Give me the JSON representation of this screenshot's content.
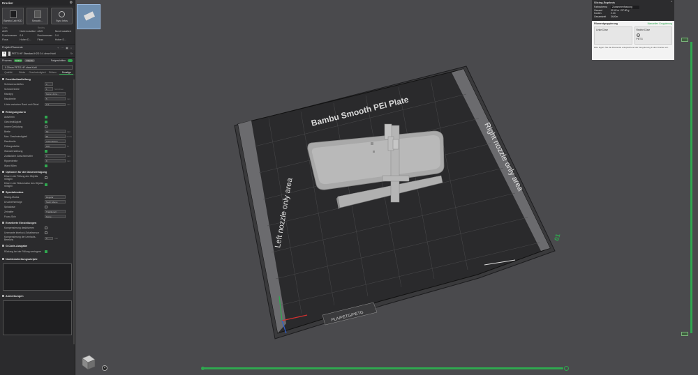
{
  "left": {
    "printer_header": "Drucker",
    "printer_name": "Bambu Lab H2D",
    "smooth_label": "Smooth...",
    "sync_label": "Sync Infos",
    "left_caption": "Links",
    "right_caption": "Rechts",
    "nozzle_info": {
      "ams_label": "AMS",
      "ams_value": "Nicht installiert",
      "diam_label": "Durchmesser",
      "diam_value": "0.4",
      "flow_label": "Fluss",
      "flow_value": "Hoher D..."
    },
    "filament_header": "Projekt-Filamente",
    "filament_1_num": "1",
    "filament_1_name": "PETG HF Standard H2D 0.4 ohne Kahl",
    "process_label": "Prozess",
    "process_pill_1": "Global",
    "process_pill_2": "Objekte",
    "advanced_label": "Fortgeschritten",
    "preset_name": "0.20mm PETG HF ohne Kahl",
    "tabs": [
      "Qualität",
      "Stärke",
      "Geschwindigkeit",
      "Stützen",
      "Sonstige"
    ],
    "groups": {
      "g1": "Druckbettaufteilung",
      "g2": "Reinigungsturm",
      "g3": "Optionen für die Düsenreinigung",
      "g4": "Spezialmodus",
      "g5": "Erweiterte Einstellungen",
      "g6": "G-Code-Ausgabe",
      "g7": "Nachbearbeitungsskripte",
      "g8": "Anmerkungen"
    },
    "rows": {
      "r1_l": "Schürzenschleifen",
      "r1_v": "0",
      "r2_l": "Schürzenhöhe",
      "r2_v": "1",
      "r2_u": "Schichten",
      "r3_l": "Randtyp",
      "r3_v": "Keine Umra...",
      "r4_l": "Randbreite",
      "r4_v": "5",
      "r4_u": "mm",
      "r5_l": "Lücke zwischen Rand und Obkel",
      "r5_v": "0.1",
      "r5_u": "mm",
      "t1": "Aktivieren",
      "t2": "Gleichmäßigkeit",
      "t3": "Innere Gerüstung",
      "t4_l": "Breite",
      "t4_v": "60",
      "t4_u": "mm",
      "t5_l": "Max. Geschwindigkeit",
      "t5_v": "90",
      "t5_u": "mm/s",
      "t6_l": "Randbreite",
      "t6_v": "Automatisch",
      "t7_l": "Füllungsdichte",
      "t7_v": "100",
      "t7_u": "%",
      "t8": "Wandverstärkung",
      "t9_l": "Zusätzliche Zwischenhafter",
      "t9_v": "0",
      "t9_u": "mm",
      "t10_l": "Rippenbreite",
      "t10_v": "8",
      "t10_u": "mm",
      "t11": "Wand füllen",
      "o1": "Düse in der Füllung des Objekts reinigen",
      "o2": "Düse in der Stützstruktur des Objekts reinigen",
      "s1_l": "Slicing-Modus",
      "s1_v": "Regulär",
      "s2_l": "Druckreihenfolge",
      "s2_v": "Nach Ebene",
      "s3": "Spiralvase",
      "s4_l": "Zeitraffer",
      "s4_v": "Traditionell",
      "s5_l": "Fuzzy Skin",
      "s5_v": "Keine",
      "e1": "Kompensierung deaktivieren",
      "e2": "Unerwarte Interlock-Schaltsensor",
      "e3_l": "Kompensierung der Leerlaufs-Bereichs",
      "e3_v": "0",
      "e3_u": "mm",
      "gc1": "Rückzug bei der Füllung verringern"
    }
  },
  "plate": {
    "title": "Bambu Smooth PEI Plate",
    "left_area": "Left nozzle only area",
    "right_area": "Right nozzle only area",
    "brand_strip": "PLA/PETG/PETG",
    "plate_number": "01"
  },
  "result": {
    "title": "Slicing-Ergebnis",
    "row1_l": "Farbschema",
    "row1_v": "Zusammenfassung",
    "row2_l": "Gesamt",
    "row2_v": "32.42 m / 97.80 g",
    "row3_l": "Kosten",
    "row3_v": "2.44",
    "row4_l": "Gesamtzeit",
    "row4_v": "3h20m",
    "fil_title": "Filamentgruppierung",
    "fil_action": "Manuellen Gruppierung",
    "left_box": "Linke Düse",
    "right_box": "Rechte Düse",
    "right_box_num": "1",
    "right_box_mat": "PETG",
    "note": "Bitte lagern Sie die Filamente entsprechend der Gruppierung in den Drucker ein."
  },
  "colors": {
    "accent": "#2fa84f",
    "panel": "#2b2b2d",
    "viewport": "#4a4a4d",
    "plate_dark": "#2a2a2c",
    "plate_strip": "#6b6b6e"
  }
}
